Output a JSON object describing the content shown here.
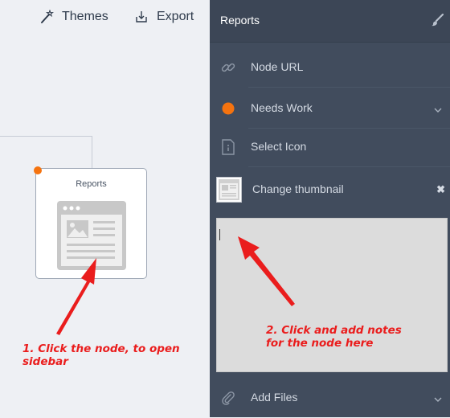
{
  "toolbar": {
    "themes_label": "Themes",
    "export_label": "Export"
  },
  "node": {
    "title": "Reports",
    "status_color": "#f5730f"
  },
  "sidebar": {
    "title": "Reports",
    "node_url_label": "Node URL",
    "status_label": "Needs Work",
    "status_color": "#f5730f",
    "select_icon_label": "Select Icon",
    "change_thumbnail_label": "Change thumbnail",
    "notes_value": "",
    "add_files_label": "Add Files"
  },
  "annotations": {
    "step1_line1": "1. Click the node, to open",
    "step1_line2": "sidebar",
    "step2_line1": "2. Click and add notes",
    "step2_line2": "for the node here"
  },
  "icons": {
    "themes": "magic-wand-icon",
    "export": "export-icon",
    "brush": "brush-icon",
    "link": "link-icon",
    "status": "status-dot-icon",
    "select_icon": "info-document-icon",
    "thumbnail": "thumbnail-icon",
    "close": "close-icon",
    "paperclip": "paperclip-icon",
    "chevron": "chevron-down-icon"
  },
  "colors": {
    "sidebar_bg": "#414c5d",
    "canvas_bg": "#eef0f4",
    "annotation_red": "#ea1d1d",
    "status_orange": "#f5730f"
  }
}
